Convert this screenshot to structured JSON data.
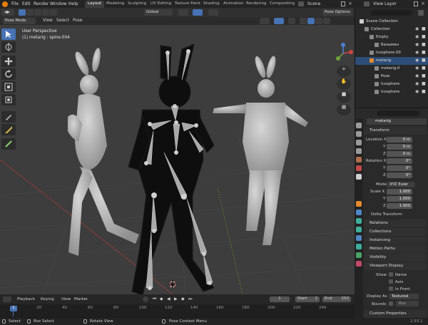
{
  "topbar": {
    "menus": [
      "File",
      "Edit",
      "Render",
      "Window",
      "Help"
    ],
    "workspaces": [
      "Layout",
      "Modeling",
      "Sculpting",
      "UV Editing",
      "Texture Paint",
      "Shading",
      "Animation",
      "Rendering",
      "Compositing"
    ],
    "active_workspace": "Layout",
    "scene": "Scene",
    "view_layer": "View Layer"
  },
  "viewport_header": {
    "orientation": "Global",
    "pose_options": "Pose Options",
    "mode": "Pose Mode",
    "menus": [
      "View",
      "Select",
      "Pose"
    ]
  },
  "viewport": {
    "view_name": "User Perspective",
    "active_info": "(1) metarig : spine.004"
  },
  "outliner": {
    "rows": [
      {
        "label": "Scene Collection",
        "indent": 0,
        "selected": false
      },
      {
        "label": "Collection",
        "indent": 1,
        "selected": false
      },
      {
        "label": "Empty",
        "indent": 2,
        "selected": false
      },
      {
        "label": "Безымян",
        "indent": 3,
        "selected": false
      },
      {
        "label": "Icosphere.00",
        "indent": 2,
        "selected": false
      },
      {
        "label": "metarig",
        "indent": 2,
        "selected": true
      },
      {
        "label": "metarig.0",
        "indent": 3,
        "selected": false
      },
      {
        "label": "Pose",
        "indent": 3,
        "selected": false
      },
      {
        "label": "Icosphere",
        "indent": 3,
        "selected": false
      },
      {
        "label": "Icosphere",
        "indent": 3,
        "selected": false
      }
    ]
  },
  "properties": {
    "object_name": "metarig",
    "transform_title": "Transform",
    "location_label": "Location X",
    "location": [
      "0 m",
      "0 m",
      "0 m"
    ],
    "rotation_label": "Rotation X",
    "rotation": [
      "0°",
      "0°",
      "0°"
    ],
    "mode_label": "Mode",
    "mode_value": "XYZ Euler",
    "scale_label": "Scale X",
    "scale": [
      "1.000",
      "1.000",
      "1.000"
    ],
    "axis_y": "Y",
    "axis_z": "Z",
    "delta_transform": "Delta Transform",
    "panels": [
      "Relations",
      "Collections",
      "Instancing",
      "Motion Paths",
      "Visibility"
    ],
    "viewport_display": "Viewport Display",
    "show_label": "Show",
    "show_options": [
      "Name",
      "Axis",
      "In Front"
    ],
    "display_as_label": "Display As",
    "display_as_value": "Textured",
    "bounds_label": "Bounds",
    "bounds_value": "Box",
    "custom_properties": "Custom Properties"
  },
  "timeline": {
    "menus": [
      "Playback",
      "Keying",
      "View",
      "Marker"
    ],
    "current_frame": "1",
    "start_label": "Start",
    "start": "1",
    "end_label": "End",
    "end": "250",
    "ticks": [
      "20",
      "40",
      "60",
      "80",
      "100",
      "120",
      "140",
      "160",
      "180",
      "200",
      "220",
      "240"
    ]
  },
  "statusbar": {
    "items": [
      "Select",
      "Box Select",
      "Rotate View",
      "Pose Context Menu"
    ],
    "version": "2.93.1"
  }
}
